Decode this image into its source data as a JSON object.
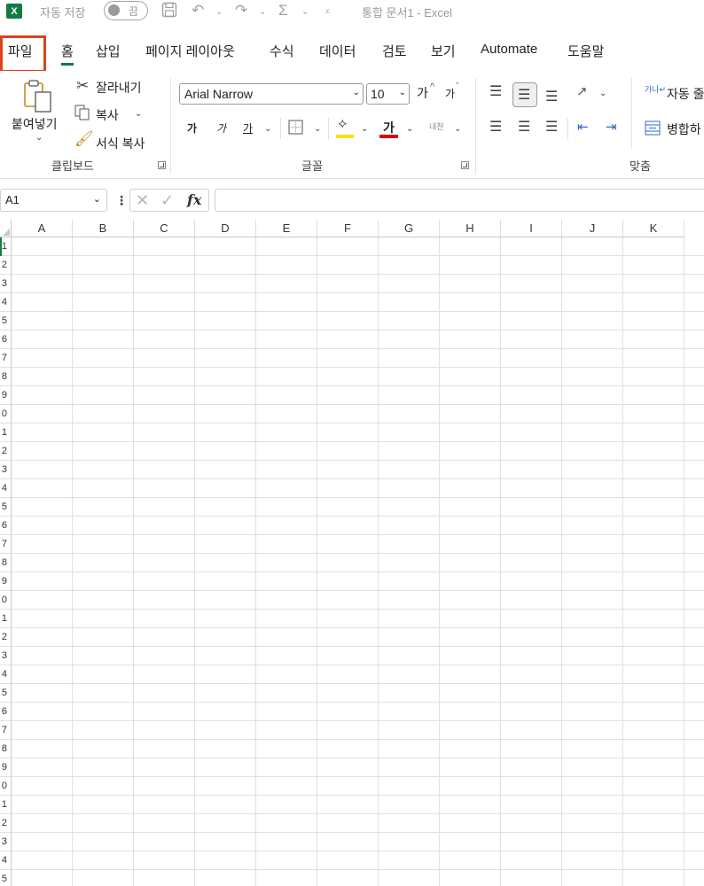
{
  "titlebar": {
    "app_icon": "X",
    "autosave_label": "자동 저장",
    "autosave_state": "끔",
    "doc_title": "통합 문서1  -  Excel"
  },
  "tabs": [
    "파일",
    "홈",
    "삽입",
    "페이지 레이아웃",
    "수식",
    "데이터",
    "검토",
    "보기",
    "Automate",
    "도움말"
  ],
  "active_tab": "홈",
  "clipboard": {
    "paste_label": "붙여넣기",
    "cut_label": "잘라내기",
    "copy_label": "복사",
    "format_painter_label": "서식 복사",
    "group_label": "클립보드"
  },
  "font": {
    "font_name": "Arial Narrow",
    "font_size": "10",
    "increase_size": "가",
    "decrease_size": "가",
    "bold": "가",
    "italic": "가",
    "underline": "가",
    "font_color_glyph": "가",
    "phonetic": "내천",
    "group_label": "글꼴"
  },
  "alignment": {
    "wrap_text_label": "자동 줄",
    "merge_label": "병합하",
    "group_label": "맞춤"
  },
  "formula_bar": {
    "name_box": "A1",
    "fx": "fx",
    "value": ""
  },
  "columns": [
    "A",
    "B",
    "C",
    "D",
    "E",
    "F",
    "G",
    "H",
    "I",
    "J",
    "K"
  ],
  "rows": [
    "1",
    "2",
    "3",
    "4",
    "5",
    "6",
    "7",
    "8",
    "9",
    "0",
    "1",
    "2",
    "3",
    "4",
    "5",
    "6",
    "7",
    "8",
    "9",
    "0",
    "1",
    "2",
    "3",
    "4",
    "5",
    "6",
    "7",
    "8",
    "9",
    "0",
    "1",
    "2",
    "3",
    "4",
    "5"
  ],
  "colors": {
    "excel_green": "#107c41",
    "highlight_red": "#e0401e",
    "fill_yellow": "#ffe000",
    "font_red": "#e00000"
  }
}
